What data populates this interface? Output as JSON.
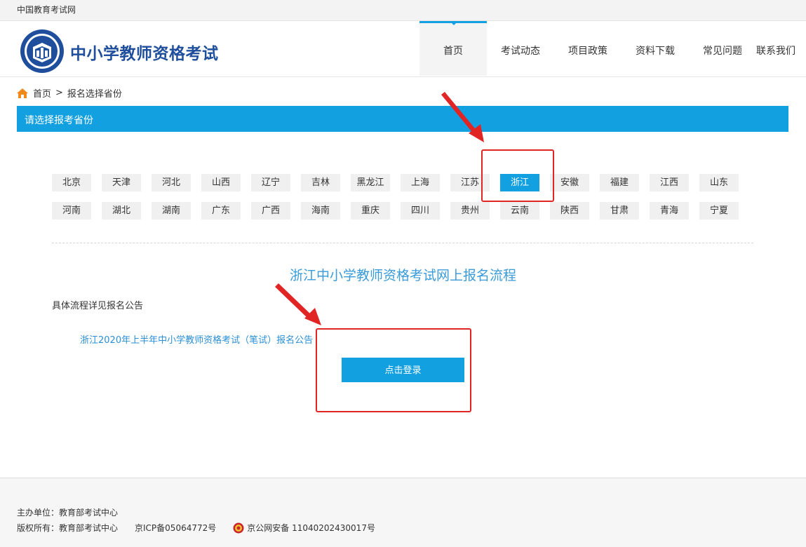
{
  "topbar": {
    "site_name": "中国教育考试网"
  },
  "header": {
    "logo_text": "中小学教师资格考试",
    "logo_icon": "exam-emblem-icon",
    "nav": [
      "首页",
      "考试动态",
      "项目政策",
      "资料下载",
      "常见问题",
      "联系我们"
    ],
    "active_nav": "首页"
  },
  "breadcrumb": {
    "home_icon": "home-icon",
    "home": "首页",
    "separator": ">",
    "current": "报名选择省份"
  },
  "section_title": "请选择报考省份",
  "provinces_row1": [
    "北京",
    "天津",
    "河北",
    "山西",
    "辽宁",
    "吉林",
    "黑龙江",
    "上海",
    "江苏",
    "浙江",
    "安徽",
    "福建",
    "江西",
    "山东"
  ],
  "provinces_row2": [
    "河南",
    "湖北",
    "湖南",
    "广东",
    "广西",
    "海南",
    "重庆",
    "四川",
    "贵州",
    "云南",
    "陕西",
    "甘肃",
    "青海",
    "宁夏"
  ],
  "selected_province": "浙江",
  "flow": {
    "title": "浙江中小学教师资格考试网上报名流程",
    "detail": "具体流程详见报名公告",
    "notice_link": "浙江2020年上半年中小学教师资格考试（笔试）报名公告",
    "login_button": "点击登录"
  },
  "footer": {
    "organizer": "主办单位：教育部考试中心",
    "copyright": "版权所有：教育部考试中心",
    "icp": "京ICP备05064772号",
    "police_icon": "police-badge-icon",
    "police_record": "京公网安备 11040202430017号"
  },
  "colors": {
    "accent": "#13a0e0",
    "brand": "#1f4f9c",
    "annotation": "#e12424",
    "link": "#2a8fd6"
  }
}
